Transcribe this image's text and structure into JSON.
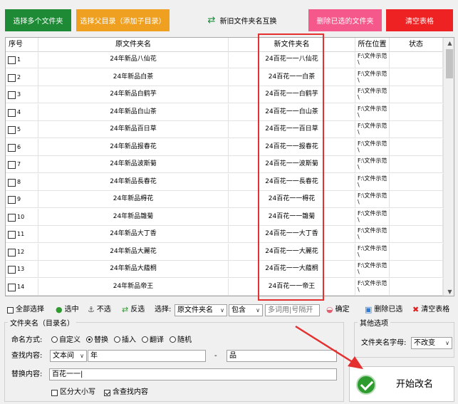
{
  "toolbar": {
    "select_folders": "选择多个文件夹",
    "select_parent": "选择父目录（添加子目录）",
    "swap_names": "新旧文件夹名互换",
    "delete_selected": "删除已选的文件夹",
    "clear_table": "清空表格"
  },
  "table": {
    "columns": [
      "序号",
      "原文件夹名",
      "新文件夹名",
      "所在位置",
      "状态"
    ],
    "rows": [
      {
        "no": "1",
        "orig": "24年新品八仙花",
        "new": "24百花一一八仙花",
        "loc": "F:\\文件示范\\"
      },
      {
        "no": "2",
        "orig": "24年新品白茶",
        "new": "24百花一一白茶",
        "loc": "F:\\文件示范\\"
      },
      {
        "no": "3",
        "orig": "24年新品白鹤芋",
        "new": "24百花一一白鹤芋",
        "loc": "F:\\文件示范\\"
      },
      {
        "no": "4",
        "orig": "24年新品白山茶",
        "new": "24百花一一白山茶",
        "loc": "F:\\文件示范\\"
      },
      {
        "no": "5",
        "orig": "24年新品百日草",
        "new": "24百花一一百日草",
        "loc": "F:\\文件示范\\"
      },
      {
        "no": "6",
        "orig": "24年新品报春花",
        "new": "24百花一一报春花",
        "loc": "F:\\文件示范\\"
      },
      {
        "no": "7",
        "orig": "24年新品波斯菊",
        "new": "24百花一一波斯菊",
        "loc": "F:\\文件示范\\"
      },
      {
        "no": "8",
        "orig": "24年新品長春花",
        "new": "24百花一一長春花",
        "loc": "F:\\文件示范\\"
      },
      {
        "no": "9",
        "orig": "24年新品棏花",
        "new": "24百花一一棏花",
        "loc": "F:\\文件示范\\"
      },
      {
        "no": "10",
        "orig": "24年新品雛菊",
        "new": "24百花一一雛菊",
        "loc": "F:\\文件示范\\"
      },
      {
        "no": "11",
        "orig": "24年新品大丁香",
        "new": "24百花一一大丁香",
        "loc": "F:\\文件示范\\"
      },
      {
        "no": "12",
        "orig": "24年新品大麗花",
        "new": "24百花一一大麗花",
        "loc": "F:\\文件示范\\"
      },
      {
        "no": "13",
        "orig": "24年新品大藴桐",
        "new": "24百花一一大藴桐",
        "loc": "F:\\文件示范\\"
      },
      {
        "no": "14",
        "orig": "24年新品帝王",
        "new": "24百花一一帝王",
        "loc": "F:\\文件示范\\"
      }
    ]
  },
  "bottom_toolbar": {
    "select_all": "全部选择",
    "check": "选中",
    "uncheck": "不选",
    "invert": "反选",
    "choose_label": "选择:",
    "field_value": "原文件夹名",
    "match_value": "包含",
    "keyword_placeholder": "多词用|号隔开",
    "confirm": "确定",
    "delete_selected": "删除已选",
    "clear_table": "清空表格"
  },
  "rename_panel": {
    "legend": "文件夹名（目录名）",
    "mode_label": "命名方式:",
    "modes": [
      "自定义",
      "替换",
      "插入",
      "翻译",
      "随机"
    ],
    "selected_mode": "替换",
    "find_label": "查找内容:",
    "find_type": "文本间",
    "find_value": "年",
    "dash": "-",
    "find_value2": "品",
    "replace_label": "替换内容:",
    "replace_value": "百花一一|",
    "case_sensitive": "区分大小写",
    "include_search": "含查找内容"
  },
  "other_options": {
    "legend": "其他选项",
    "case_label": "文件夹名字母:",
    "case_value": "不改变"
  },
  "start_button": "开始改名",
  "colors": {
    "green_btn": "#1e8a36",
    "orange_btn": "#f0a020",
    "pink_btn": "#f5588a",
    "red_btn": "#ee2222",
    "highlight_box": "#e53030"
  }
}
